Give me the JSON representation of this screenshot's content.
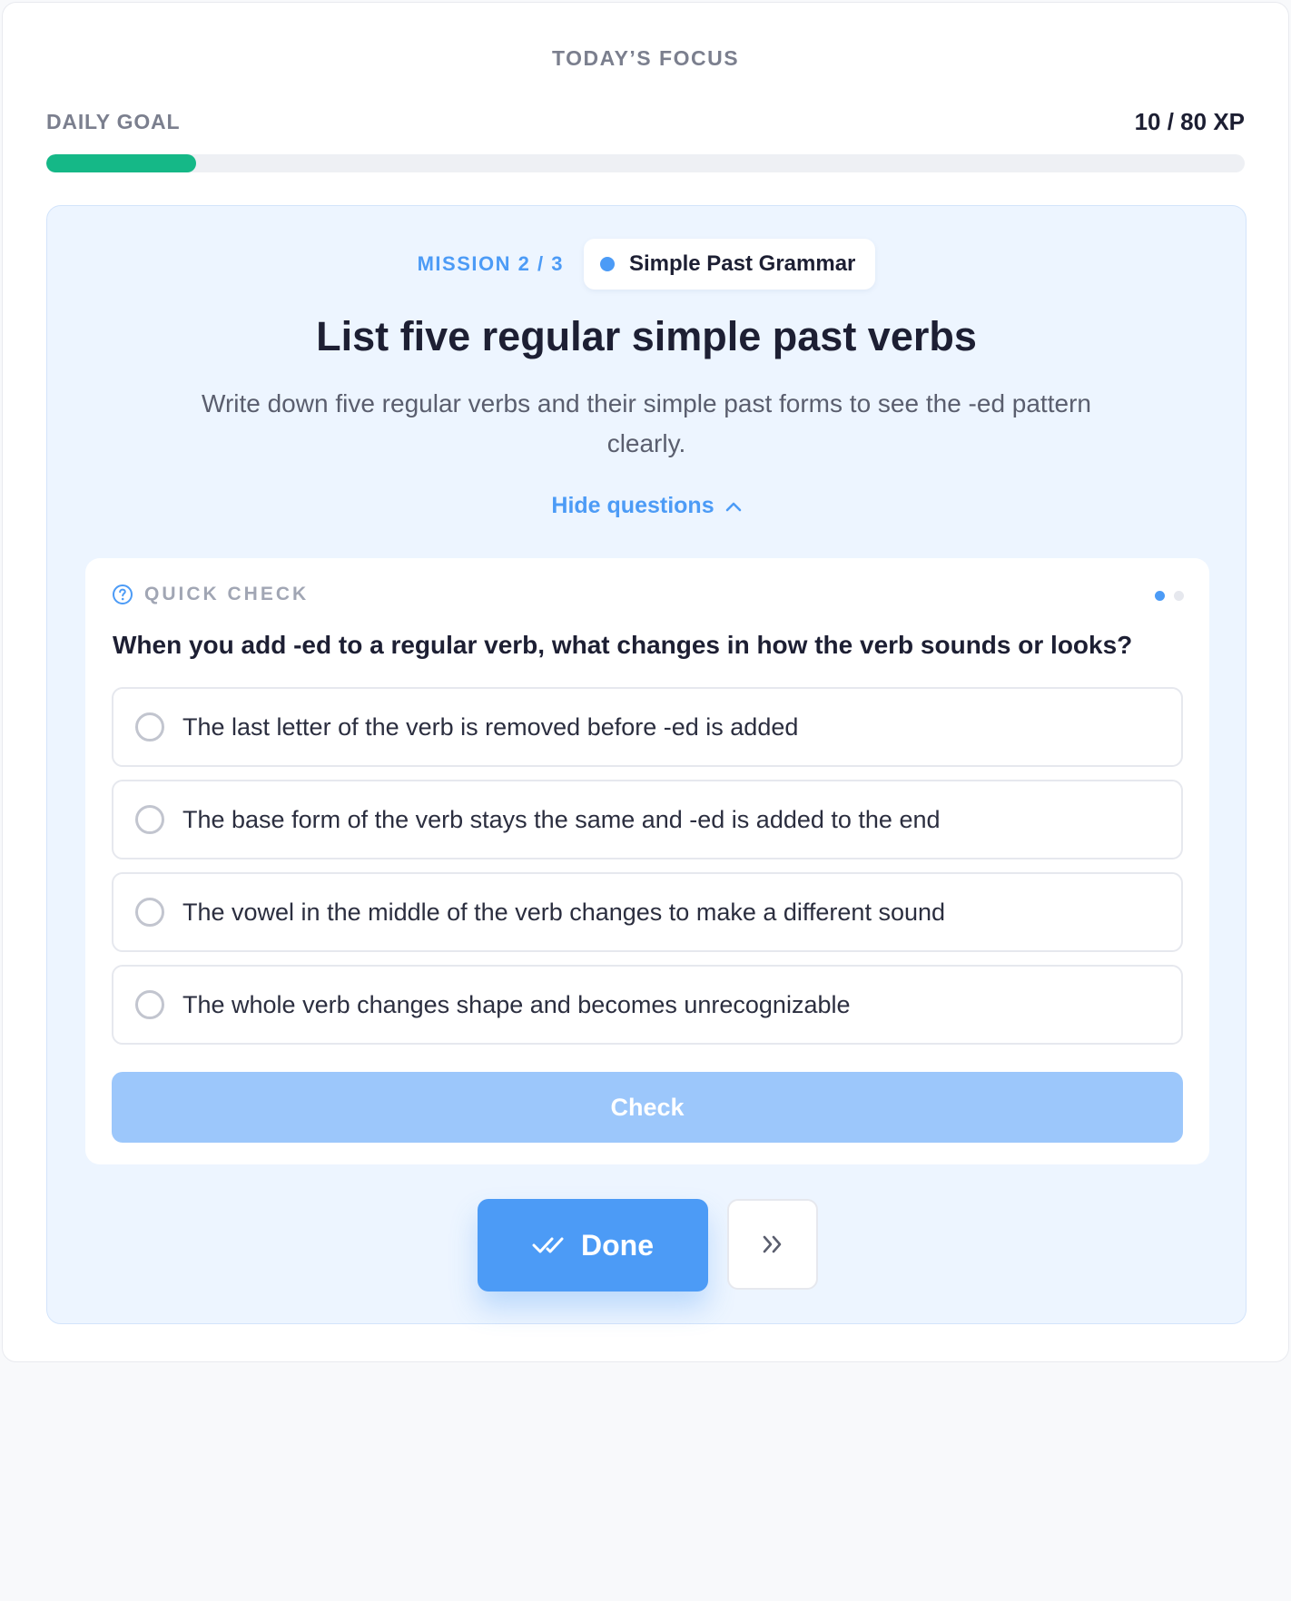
{
  "header": {
    "focus_label": "TODAY’S FOCUS"
  },
  "daily_goal": {
    "label": "DAILY GOAL",
    "xp_text": "10 / 80 XP",
    "progress_fraction": 0.125,
    "progress_color": "#15b887"
  },
  "mission": {
    "count_label": "MISSION 2 / 3",
    "topic": "Simple Past Grammar",
    "title": "List five regular simple past verbs",
    "description": "Write down five regular verbs and their simple past forms to see the -ed pattern clearly.",
    "toggle_label": "Hide questions",
    "toggle_icon": "chevron-up-icon"
  },
  "quiz": {
    "label": "QUICK CHECK",
    "label_icon": "question-circle-icon",
    "question": "When you add -ed to a regular verb, what changes in how the verb sounds or looks?",
    "options": [
      "The last letter of the verb is removed before -ed is added",
      "The base form of the verb stays the same and -ed is added to the end",
      "The vowel in the middle of the verb changes to make a different sound",
      "The whole verb changes shape and becomes unrecognizable"
    ],
    "check_label": "Check",
    "page_dots": {
      "total": 2,
      "active": 1
    }
  },
  "actions": {
    "done_label": "Done",
    "done_icon": "double-check-icon",
    "skip_icon": "double-chevron-right-icon"
  },
  "colors": {
    "accent": "#4c9bf6",
    "accent_disabled": "#9cc7fb",
    "panel_bg": "#edf5ff",
    "text_primary": "#1d1f33",
    "text_muted": "#7b7f8e"
  }
}
